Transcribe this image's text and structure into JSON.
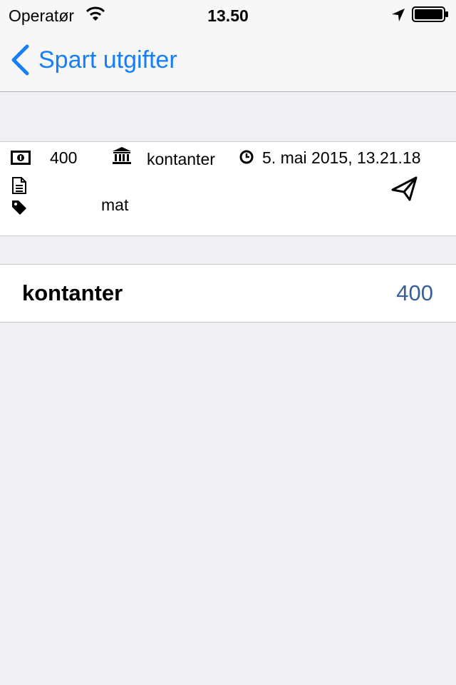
{
  "status_bar": {
    "carrier": "Operatør",
    "time": "13.50"
  },
  "nav": {
    "back_label": "Spart utgifter"
  },
  "detail": {
    "amount": "400",
    "account": "kontanter",
    "date": "5. mai 2015, 13.21.18",
    "note": "",
    "tag": "mat"
  },
  "summary": {
    "label": "kontanter",
    "value": "400"
  },
  "colors": {
    "accent": "#157efb",
    "value": "#385f99",
    "background": "#efeff4"
  },
  "icons": {
    "amount": "money-icon",
    "account": "bank-icon",
    "date": "clock-icon",
    "note": "document-icon",
    "tag": "tag-icon",
    "share": "paper-plane-icon"
  }
}
